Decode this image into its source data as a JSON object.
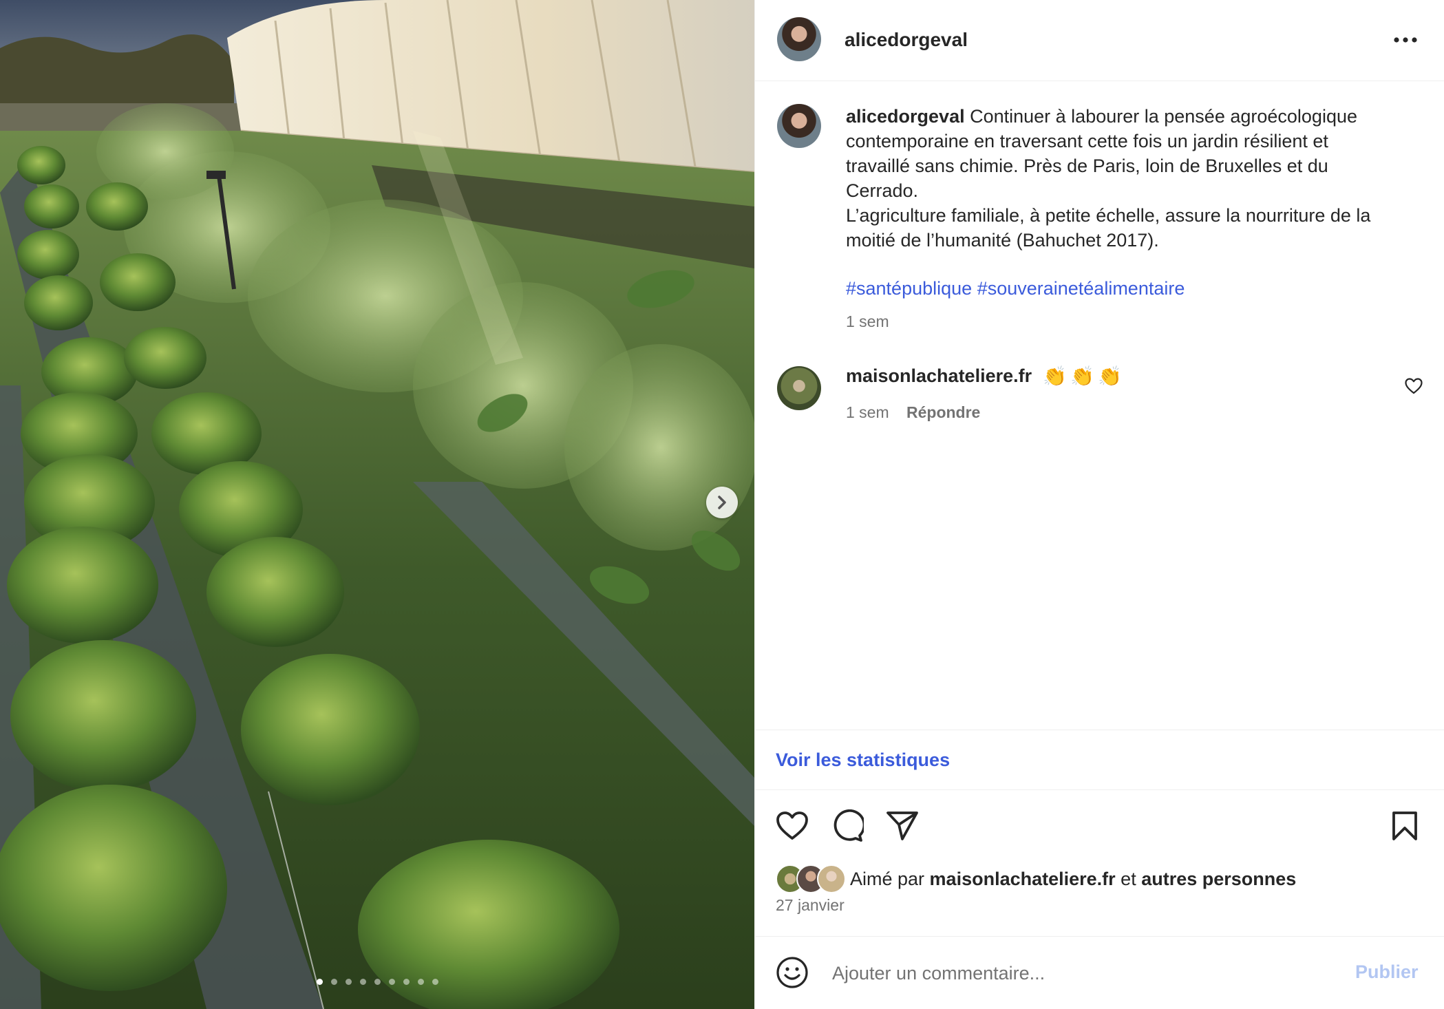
{
  "post": {
    "image_alt": "Photo de potager : rangs de chou kale et de fenouil le long d'une serre",
    "carousel": {
      "total": 9,
      "active": 1
    }
  },
  "header": {
    "username": "alicedorgeval",
    "more_glyph": "•••"
  },
  "caption": {
    "username": "alicedorgeval",
    "text": " Continuer à labourer la pensée agroécologique contemporaine en traversant cette fois un jardin résilient et travaillé sans chimie. Près de Paris, loin de Bruxelles et du Cerrado.",
    "text2": "L’agriculture familiale, à petite échelle, assure la nourriture de la moitié de l’humanité (Bahuchet 2017).",
    "hashtags": [
      "#santépublique",
      "#souverainetéalimentaire"
    ],
    "time": "1 sem"
  },
  "comment": {
    "username": "maisonlachateliere.fr",
    "emojis": [
      "👏",
      "👏",
      "👏"
    ],
    "time": "1 sem",
    "reply_label": "Répondre"
  },
  "stats": {
    "link": "Voir les statistiques"
  },
  "likes": {
    "prefix": "Aimé par ",
    "user": "maisonlachateliere.fr",
    "middle": " et ",
    "others": "autres personnes",
    "date": "27 janvier"
  },
  "composer": {
    "placeholder": "Ajouter un commentaire...",
    "publish_label": "Publier"
  },
  "colors": {
    "link_blue": "#3b5bdb",
    "publish_disabled": "#b2c6f2",
    "meta_grey": "#737373",
    "text": "#262626"
  }
}
